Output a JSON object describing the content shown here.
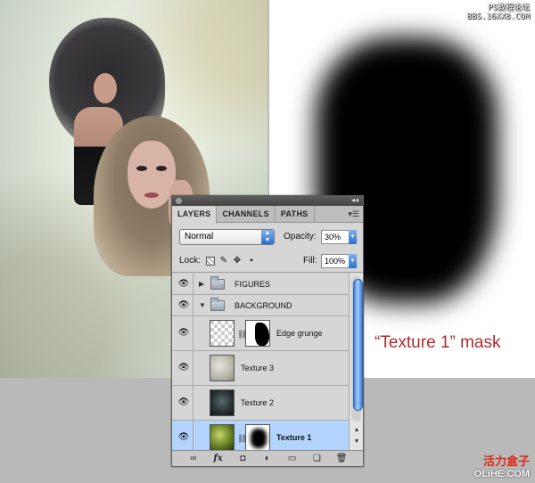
{
  "watermark": {
    "line1": "PS教程论坛",
    "line2": "BBS.16XX8.COM"
  },
  "caption": "“Texture 1” mask",
  "brand": {
    "cn": "活力盒子",
    "en": "OLiHE.COM"
  },
  "panel": {
    "tabs": [
      "LAYERS",
      "CHANNELS",
      "PATHS"
    ],
    "active_tab": "LAYERS",
    "blend_mode": "Normal",
    "opacity_label": "Opacity:",
    "opacity_value": "30%",
    "lock_label": "Lock:",
    "fill_label": "Fill:",
    "fill_value": "100%",
    "layers": [
      {
        "name": "FIGURES",
        "type": "group",
        "expanded": false,
        "visible": true
      },
      {
        "name": "BACKGROUND",
        "type": "group",
        "expanded": true,
        "visible": true
      },
      {
        "name": "Edge grunge",
        "type": "layer",
        "has_mask": true,
        "visible": true
      },
      {
        "name": "Texture 3",
        "type": "layer",
        "has_mask": false,
        "visible": true
      },
      {
        "name": "Texture 2",
        "type": "layer",
        "has_mask": false,
        "visible": true
      },
      {
        "name": "Texture 1",
        "type": "layer",
        "has_mask": true,
        "visible": true,
        "selected": true
      }
    ],
    "bottom_icons": [
      "link-icon",
      "fx-icon",
      "add-mask-icon",
      "adjustment-layer-icon",
      "new-group-icon",
      "new-layer-icon",
      "trash-icon"
    ]
  },
  "colors": {
    "caption": "#b52a2f",
    "brand_cn": "#d82b17",
    "selection": "#b3d4fd",
    "scroll_thumb": "#3d7fd6"
  }
}
